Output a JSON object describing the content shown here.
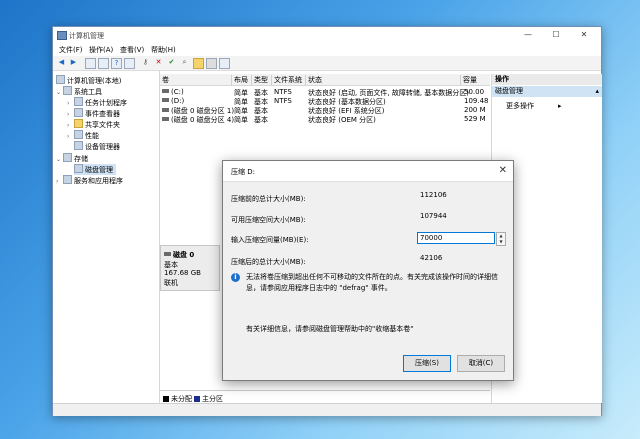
{
  "window": {
    "title": "计算机管理",
    "min": "—",
    "max": "☐",
    "close": "✕"
  },
  "menu": [
    "文件(F)",
    "操作(A)",
    "查看(V)",
    "帮助(H)"
  ],
  "toolbar_icons": [
    "back-arrow-icon",
    "forward-arrow-icon",
    "folder-icon",
    "grid-icon",
    "help-icon",
    "list-icon",
    "key-icon",
    "delete-icon",
    "check-icon",
    "search-icon",
    "folder-open-icon",
    "drive-icon",
    "properties-icon"
  ],
  "tree": {
    "root": "计算机管理(本地)",
    "system_tools": "系统工具",
    "task_scheduler": "任务计划程序",
    "event_viewer": "事件查看器",
    "shared_folders": "共享文件夹",
    "performance": "性能",
    "device_manager": "设备管理器",
    "storage": "存储",
    "disk_management": "磁盘管理",
    "services_apps": "服务和应用程序"
  },
  "list": {
    "columns": [
      "卷",
      "布局",
      "类型",
      "文件系统",
      "状态",
      "容量"
    ],
    "rows": [
      [
        "(C:)",
        "简单",
        "基本",
        "NTFS",
        "状态良好 (启动, 页面文件, 故障转储, 基本数据分区)",
        "50.00"
      ],
      [
        "(D:)",
        "简单",
        "基本",
        "NTFS",
        "状态良好 (基本数据分区)",
        "109.48"
      ],
      [
        "(磁盘 0 磁盘分区 1)",
        "简单",
        "基本",
        "",
        "状态良好 (EFI 系统分区)",
        "200 M"
      ],
      [
        "(磁盘 0 磁盘分区 4)",
        "简单",
        "基本",
        "",
        "状态良好 (OEM 分区)",
        "529 M"
      ]
    ]
  },
  "disk": {
    "name": "磁盘 0",
    "type": "基本",
    "size": "167.68 GB",
    "status": "联机"
  },
  "legend": {
    "unallocated": "未分配",
    "primary": "主分区"
  },
  "actions": {
    "header": "操作",
    "section": "磁盘管理",
    "more": "更多操作"
  },
  "dialog": {
    "title": "压缩 D:",
    "total_before_label": "压缩前的总计大小(MB):",
    "total_before": "112106",
    "available_label": "可用压缩空间大小(MB):",
    "available": "107944",
    "input_label": "输入压缩空间量(MB)(E):",
    "input_value": "70000",
    "total_after_label": "压缩后的总计大小(MB):",
    "total_after": "42106",
    "note": "无法将卷压缩到超出任何不可移动的文件所在的点。有关完成该操作时间的详细信息，请参阅应用程序日志中的 \"defrag\" 事件。",
    "more_info": "有关详细信息，请参阅磁盘管理帮助中的\"收缩基本卷\"",
    "shrink_button": "压缩(S)",
    "cancel_button": "取消(C)"
  },
  "colors": {
    "unallocated": "#000000",
    "primary": "#1a2e8a",
    "selection": "#cfe3f5",
    "accent": "#0078d7"
  }
}
